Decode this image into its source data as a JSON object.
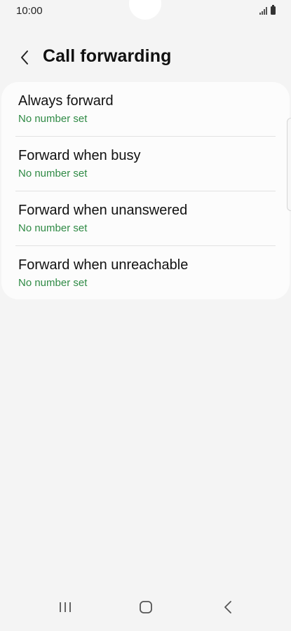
{
  "status_bar": {
    "time": "10:00"
  },
  "header": {
    "title": "Call forwarding",
    "back_icon": "chevron-left-icon"
  },
  "forwarding_options": [
    {
      "title": "Always forward",
      "subtitle": "No number set"
    },
    {
      "title": "Forward when busy",
      "subtitle": "No number set"
    },
    {
      "title": "Forward when unanswered",
      "subtitle": "No number set"
    },
    {
      "title": "Forward when unreachable",
      "subtitle": "No number set"
    }
  ],
  "nav_bar": {
    "recents_icon": "recents-icon",
    "home_icon": "home-icon",
    "back_icon": "back-icon"
  },
  "colors": {
    "subtitle": "#2f8a45",
    "background": "#f4f4f4",
    "card": "#fcfcfc"
  }
}
